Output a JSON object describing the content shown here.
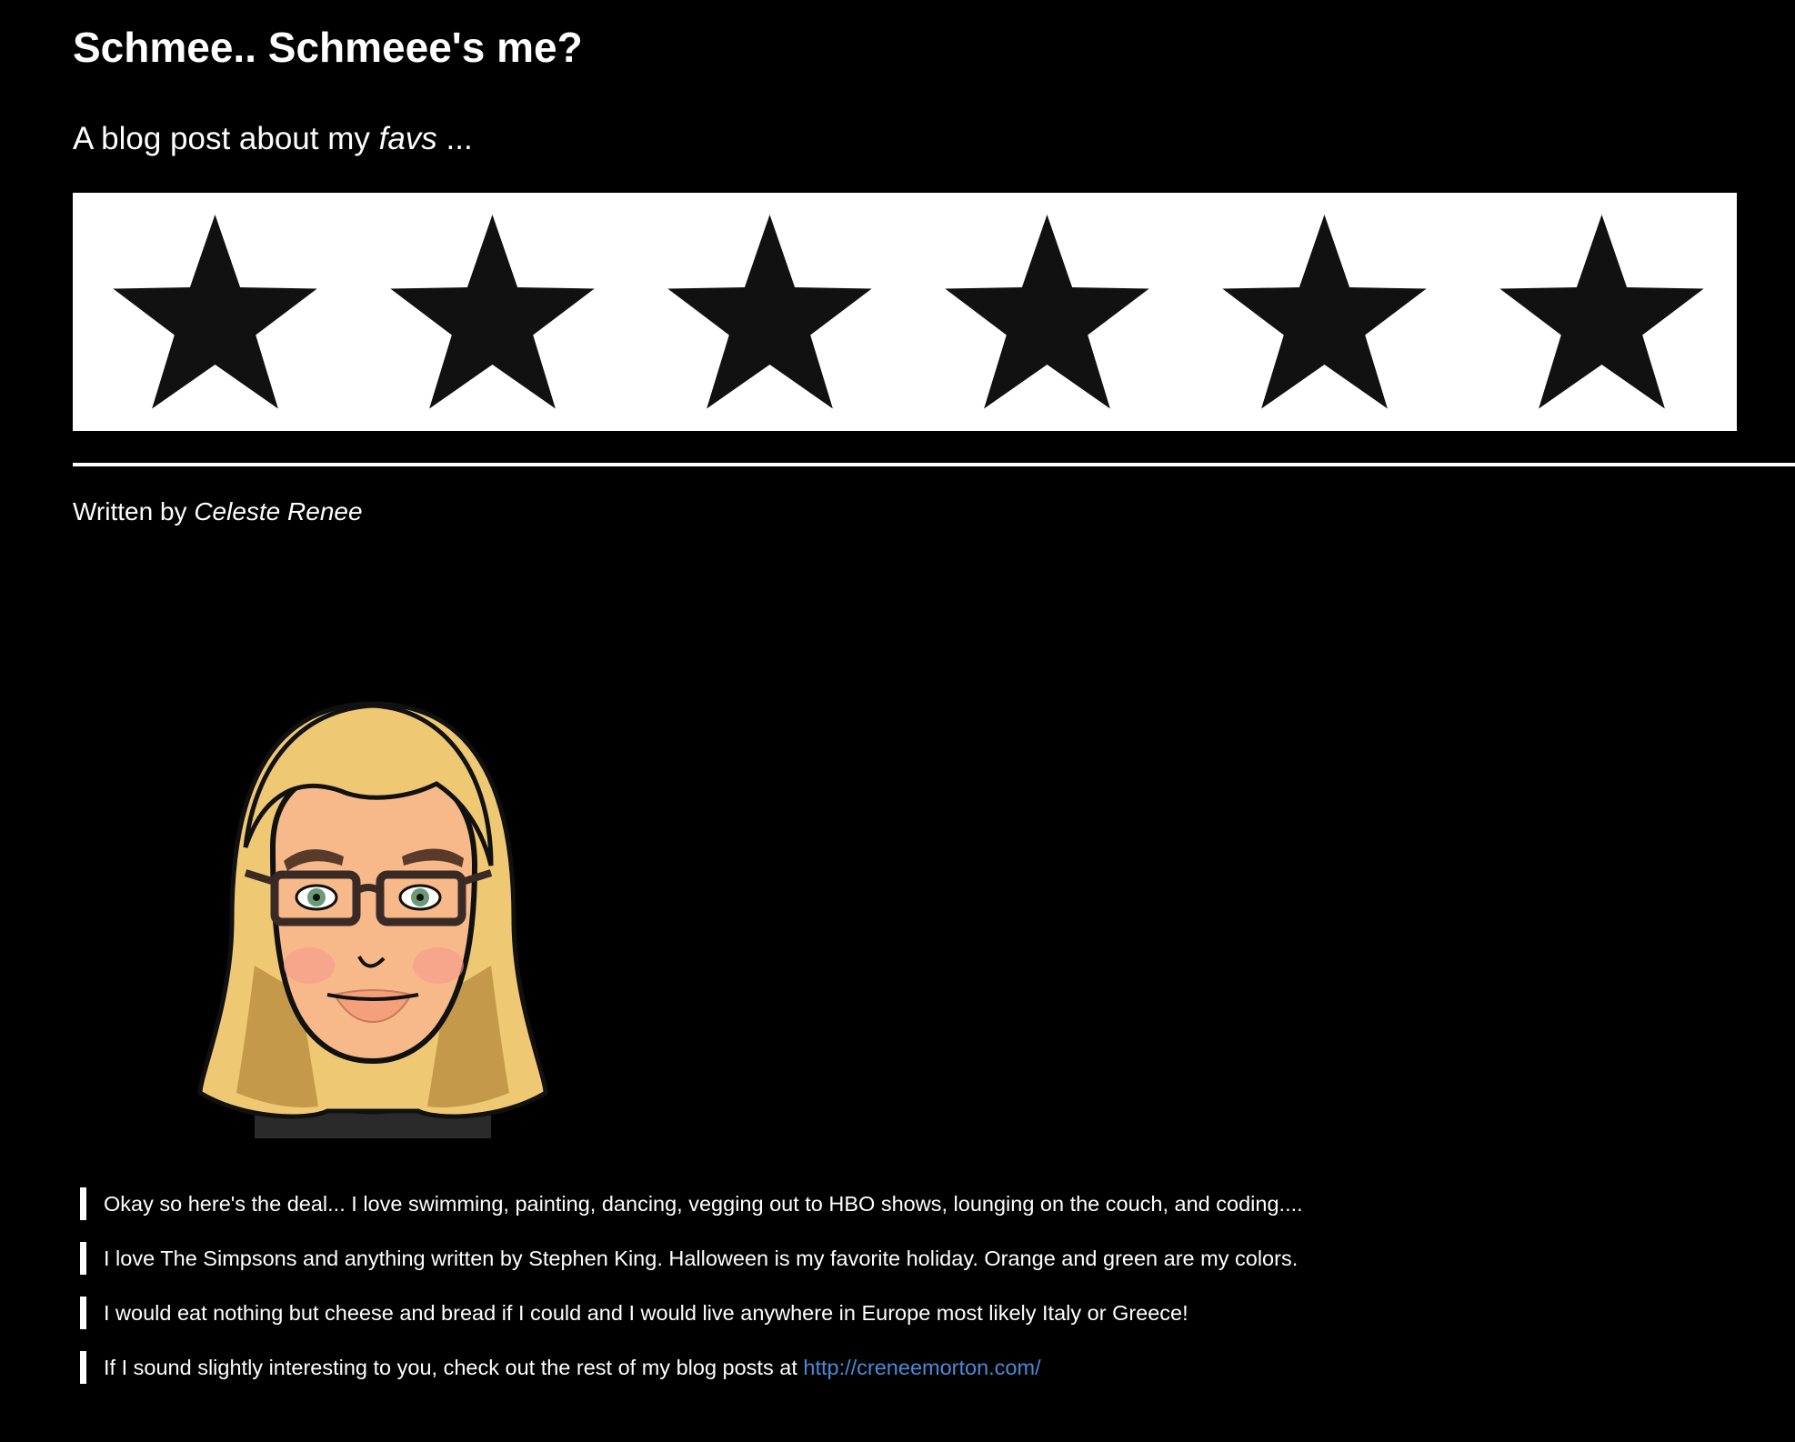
{
  "header": {
    "title": "Schmee.. Schmeee's me?",
    "subtitle_prefix": "A blog post about my ",
    "subtitle_emphasis": "favs",
    "subtitle_suffix": " ..."
  },
  "banner": {
    "star_count": 6,
    "background_color": "#ffffff",
    "star_color": "#111111",
    "icon": "star-icon"
  },
  "byline": {
    "prefix": "Written by ",
    "author": "Celeste Renee"
  },
  "avatar": {
    "icon": "bitmoji-avatar-icon"
  },
  "body": {
    "lines": [
      "Okay so here's the deal... I love swimming, painting, dancing, vegging out to HBO shows, lounging on the couch, and coding....",
      "I love The Simpsons and anything written by Stephen King. Halloween is my favorite holiday. Orange and green are my colors.",
      "I would eat nothing but cheese and bread if I could and I would live anywhere in Europe most likely Italy or Greece!"
    ],
    "last_line_prefix": "If I sound slightly interesting to you, check out the rest of my blog posts at ",
    "link_text": "http://creneemorton.com/"
  },
  "colors": {
    "background": "#000000",
    "text": "#ffffff",
    "link": "#4a8bd8"
  }
}
